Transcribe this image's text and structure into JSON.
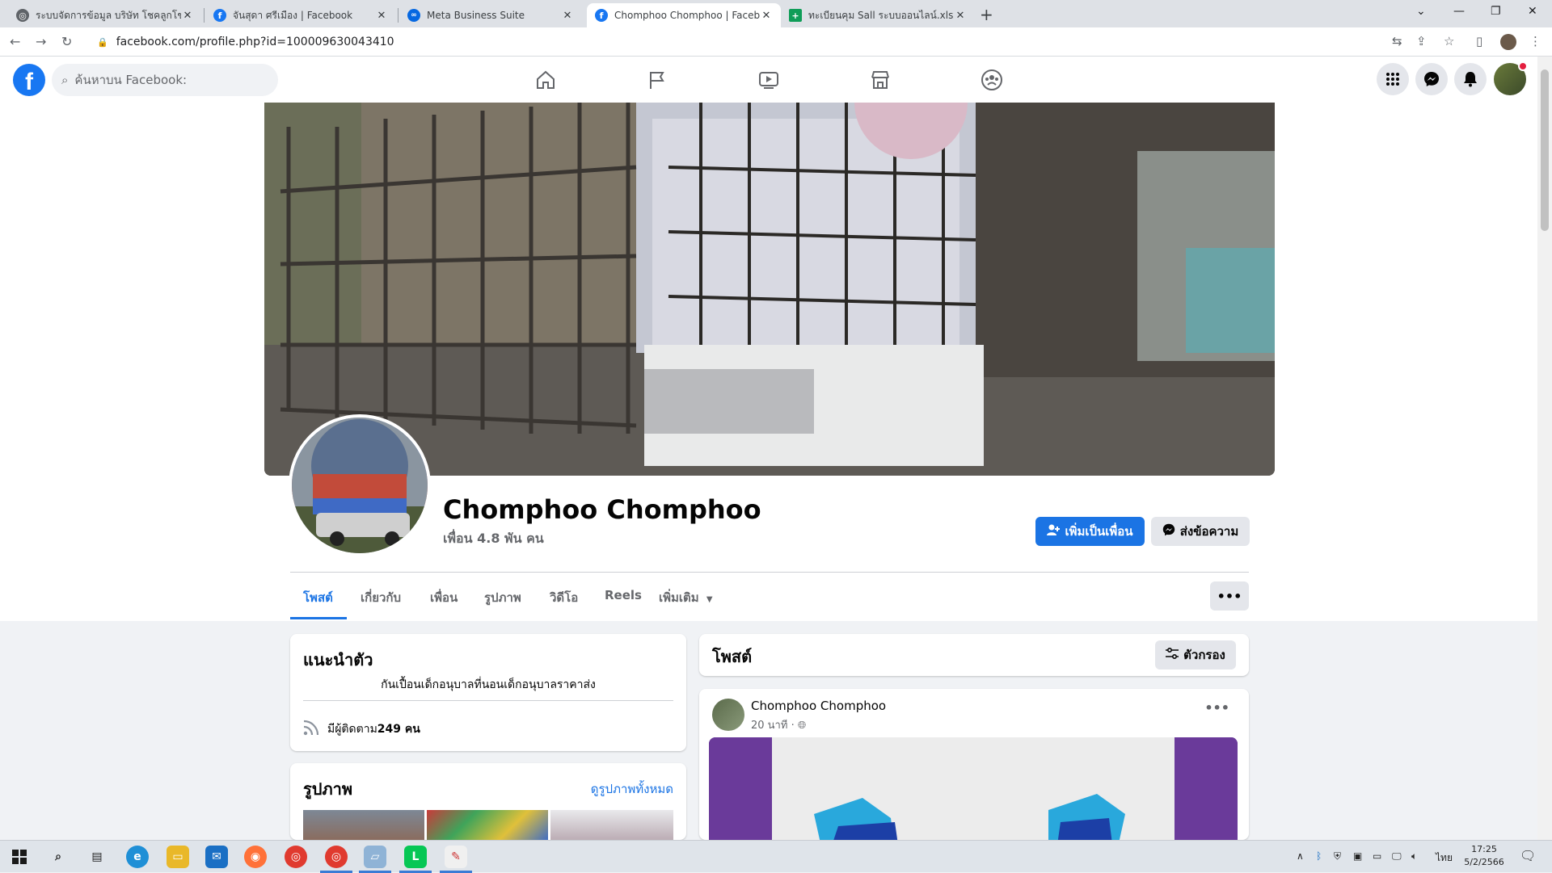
{
  "browser": {
    "tabs": [
      {
        "title": "ระบบจัดการข้อมูล บริษัท โชคลูกโชค",
        "favicon": "globe-icon"
      },
      {
        "title": "จันสุดา ศรีเมือง | Facebook",
        "favicon": "facebook-icon"
      },
      {
        "title": "Meta Business Suite",
        "favicon": "meta-icon"
      },
      {
        "title": "Chomphoo Chomphoo | Facebook",
        "favicon": "facebook-icon"
      },
      {
        "title": "ทะเบียนคุม Sall ระบบออนไลน์.xlsx - G",
        "favicon": "sheets-icon"
      }
    ],
    "active_tab_index": 3,
    "url": "facebook.com/profile.php?id=100009630043410"
  },
  "fb_header": {
    "search_placeholder": "ค้นหาบน Facebook:",
    "brand_color": "#1877f2"
  },
  "profile": {
    "name": "Chomphoo Chomphoo",
    "friends": "เพื่อน 4.8 พัน คน",
    "add_friend_label": "เพิ่มเป็นเพื่อน",
    "message_label": "ส่งข้อความ",
    "tabs": [
      "โพสต์",
      "เกี่ยวกับ",
      "เพื่อน",
      "รูปภาพ",
      "วิดีโอ",
      "Reels",
      "เพิ่มเติม"
    ],
    "active_tab": "โพสต์"
  },
  "intro": {
    "title": "แนะนำตัว",
    "bio": "กันเปื้อนเด็กอนุบาลที่นอนเด็กอนุบาลราคาส่ง",
    "followers_prefix": "มีผู้ติดตาม ",
    "followers_count": "249 คน"
  },
  "photos": {
    "title": "รูปภาพ",
    "see_all": "ดูรูปภาพทั้งหมด"
  },
  "posts": {
    "title": "โพสต์",
    "filter_label": "ตัวกรอง",
    "items": [
      {
        "author": "Chomphoo Chomphoo",
        "time": "20 นาที ·"
      }
    ]
  },
  "taskbar": {
    "language": "ไทย",
    "time": "17:25",
    "date": "5/2/2566"
  }
}
